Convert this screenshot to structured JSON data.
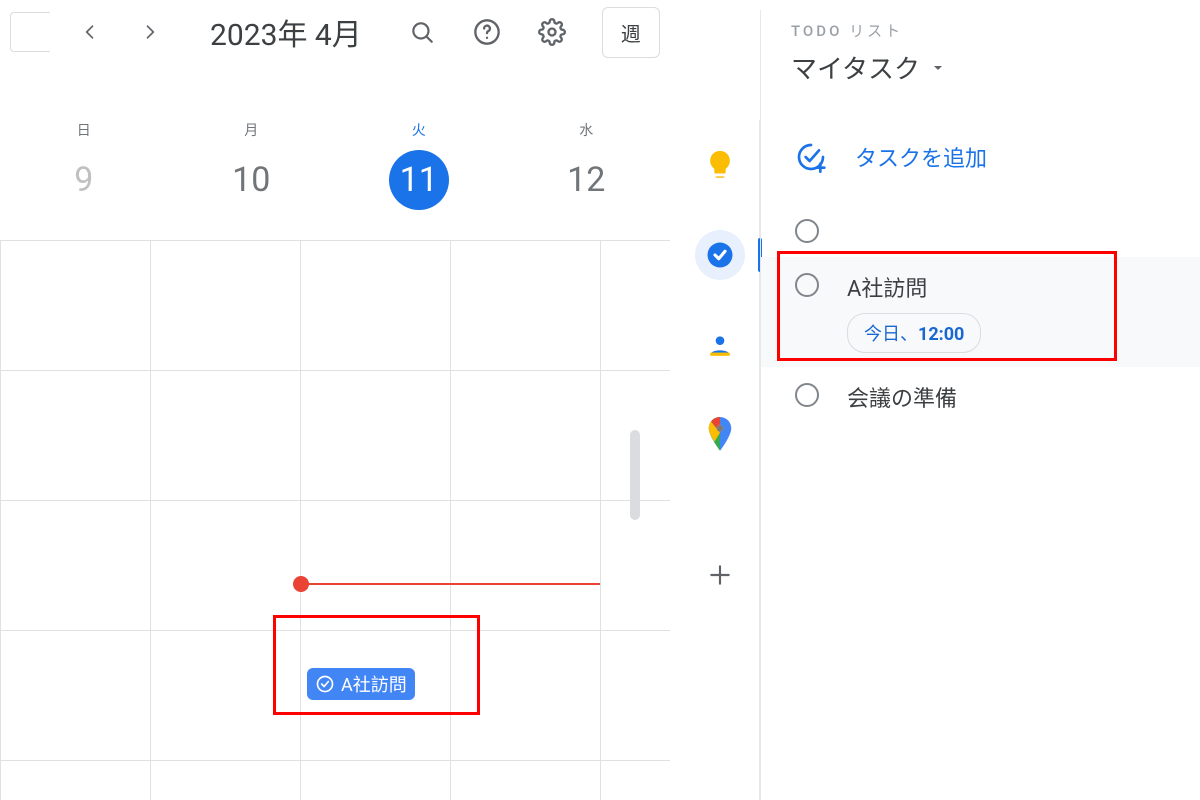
{
  "header": {
    "date_title": "2023年 4月",
    "view_label": "週"
  },
  "days": [
    {
      "dow": "日",
      "num": "9"
    },
    {
      "dow": "月",
      "num": "10"
    },
    {
      "dow": "火",
      "num": "11",
      "today": true
    },
    {
      "dow": "水",
      "num": "12"
    }
  ],
  "event": {
    "title": "A社訪問"
  },
  "tasks_panel": {
    "header": "TODO リスト",
    "list_name": "マイタスク",
    "add_label": "タスクを追加",
    "items": [
      {
        "title": ""
      },
      {
        "title": "A社訪問",
        "date_prefix": "今日、",
        "date_time": "12:00",
        "highlight": true
      },
      {
        "title": "会議の準備"
      }
    ]
  }
}
